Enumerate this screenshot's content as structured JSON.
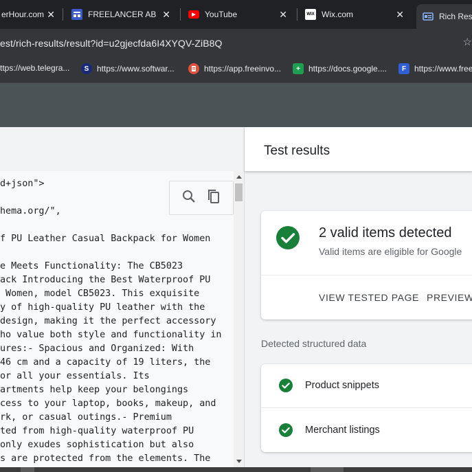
{
  "browser": {
    "tabs": [
      {
        "label": "erHour.com",
        "icon": "generic-site-icon",
        "icon_text": "",
        "icon_color": "#202124",
        "active": false
      },
      {
        "label": "FREELANCER ABDU",
        "icon": "freelancer-site-icon",
        "icon_text": "",
        "icon_color": "#3b5bcc",
        "active": false
      },
      {
        "label": "YouTube",
        "icon": "youtube-icon",
        "icon_text": "▶",
        "icon_color": "#ff0000",
        "active": false
      },
      {
        "label": "Wix.com",
        "icon": "wix-icon",
        "icon_text": "WIX",
        "icon_color": "#ffffff",
        "active": false
      },
      {
        "label": "Rich Resu",
        "icon": "rich-results-icon",
        "icon_text": "",
        "icon_color": "#8ab4f8",
        "active": true
      }
    ],
    "close_glyph": "✕",
    "url": "est/rich-results/result?id=u2gjecfda6I4XYQV-ZiB8Q",
    "bookmarks": [
      {
        "label": "ttps://web.telegra...",
        "icon": "telegram-icon",
        "icon_text": "",
        "icon_color": "#2aa3e0"
      },
      {
        "label": "https://www.softwar...",
        "icon": "software-site-icon",
        "icon_text": "S",
        "icon_color": "#1a2a7a"
      },
      {
        "label": "https://app.freeinvo...",
        "icon": "freeinvoice-icon",
        "icon_text": "",
        "icon_color": "#e0503a"
      },
      {
        "label": "https://docs.google....",
        "icon": "google-sheets-icon",
        "icon_text": "+",
        "icon_color": "#1e9e4f"
      },
      {
        "label": "https://www.free",
        "icon": "freelancer-site-icon",
        "icon_text": "F",
        "icon_color": "#2f5fd0"
      }
    ]
  },
  "code": {
    "lines": [
      "d+json\">",
      "",
      "hema.org/\",",
      "",
      "f PU Leather Casual Backpack for Women",
      "",
      "e Meets Functionality: The CB5023",
      "ack Introducing the Best Waterproof PU",
      " Women, model CB5023. This exquisite",
      "y of high-quality PU leather with the",
      "design, making it the perfect accessory",
      "ho value both style and functionality in",
      "ures:- Spacious and Organized: With",
      "46 cm and a capacity of 19 liters, the",
      "or all your essentials. Its",
      "artments help keep your belongings",
      "cess to your laptop, books, makeup, and",
      "rk, or casual outings.- Premium",
      "ted from high-quality waterproof PU",
      "only exudes sophistication but also",
      "s are protected from the elements. The"
    ]
  },
  "results": {
    "title": "Test results",
    "valid_title": "2 valid items detected",
    "valid_subtitle": "Valid items are eligible for Google",
    "view_tested_page": "VIEW TESTED PAGE",
    "preview": "PREVIEW R",
    "detected_label": "Detected structured data",
    "items": [
      {
        "label": "Product snippets"
      },
      {
        "label": "Merchant listings"
      }
    ]
  },
  "colors": {
    "check_green": "#188038",
    "app_header": "#4a5457"
  }
}
